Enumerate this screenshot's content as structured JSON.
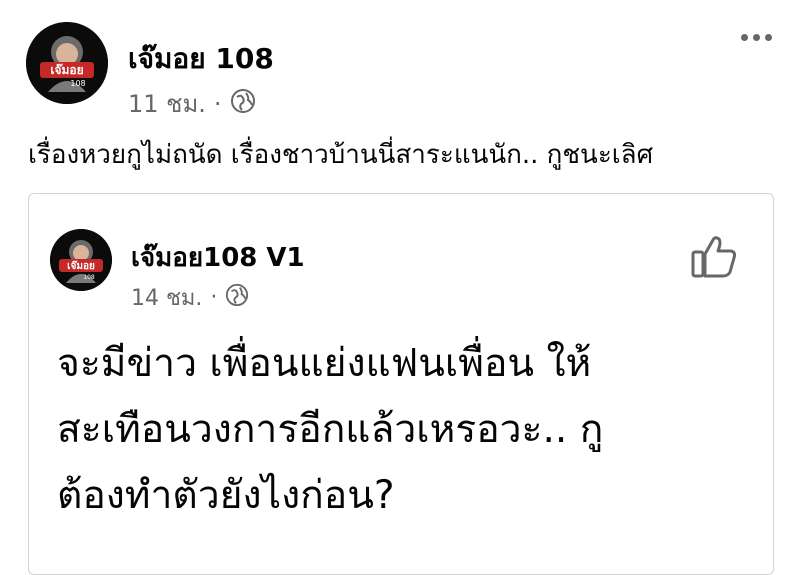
{
  "post": {
    "author_name": "เจ๊มอย 108",
    "time": "11 ชม.",
    "separator": "·",
    "avatar_text": "เจ๊มอย",
    "avatar_subtext": "108",
    "text": "เรื่องหวยกูไม่ถนัด เรื่องชาวบ้านนี่สาระแนนัก.. กูชนะเลิศ"
  },
  "shared": {
    "author_name": "เจ๊มอย108 V1",
    "time": "14 ชม.",
    "separator": "·",
    "avatar_text": "เจ๊มอย",
    "avatar_subtext": "108",
    "lines": [
      "จะมีข่าว เพื่อนแย่งแฟนเพื่อน ให้",
      "สะเทือนวงการอีกแล้วเหรอวะ.. กู",
      "ต้องทำตัวยังไงก่อน?"
    ]
  },
  "colors": {
    "meta": "#65676b",
    "border": "#d0d2d6",
    "avatar_badge": "#c62828"
  },
  "icons": [
    "globe-icon",
    "more-icon",
    "like-icon"
  ]
}
